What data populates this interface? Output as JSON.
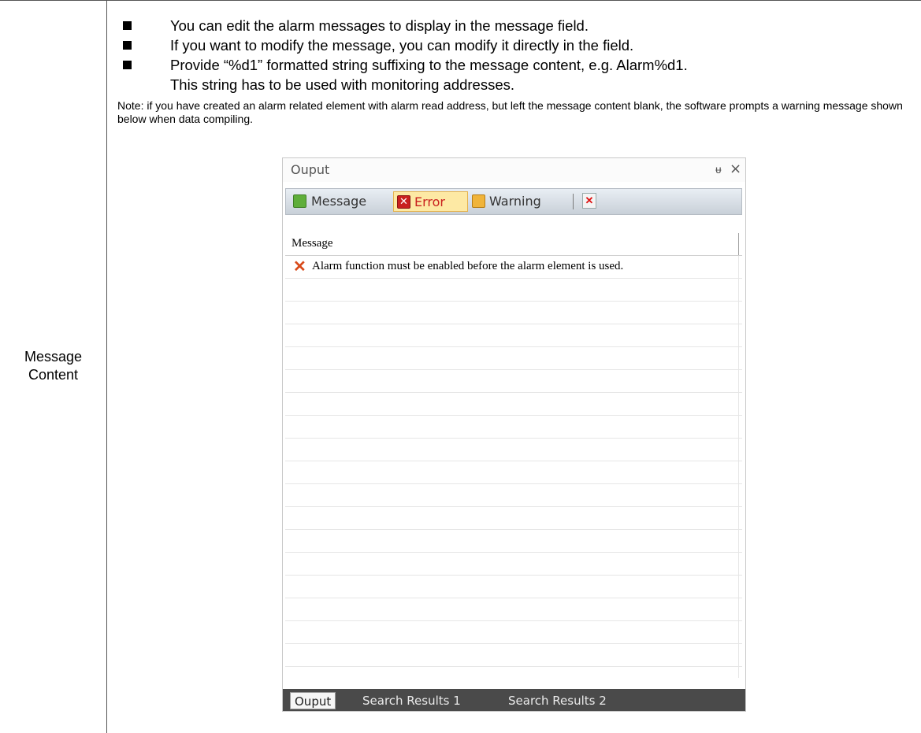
{
  "document": {
    "row_label": "Message Content",
    "bullets": [
      {
        "text": "You can edit the alarm messages to display in the message field."
      },
      {
        "text": "If you want to modify the message, you can modify it directly in the field."
      },
      {
        "text": "Provide “%d1” formatted string suffixing to the message content, e.g. Alarm%d1.",
        "line2": "This string has to be used with monitoring addresses."
      }
    ],
    "note": "Note: if you have created an alarm related element with alarm read address, but left the message content blank, the software prompts a warning message shown below when data compiling."
  },
  "output_panel": {
    "title": "Ouput",
    "pin_glyph": "ᵾ",
    "close_glyph": "×",
    "toolbar": {
      "message_label": "Message",
      "error_label": "Error",
      "warning_label": "Warning",
      "active": "Error"
    },
    "grid": {
      "column_header": "Message",
      "rows": [
        {
          "icon": "error-icon",
          "text": "Alarm function must be enabled before the alarm element is used."
        }
      ]
    },
    "tabs": [
      {
        "label": "Ouput",
        "active": true
      },
      {
        "label": "Search Results 1",
        "active": false
      },
      {
        "label": "Search Results 2",
        "active": false
      }
    ]
  },
  "colors": {
    "error_accent": "#c9201e",
    "active_tab_bg": "#fde9a4",
    "tabbar_bg": "#4a4a4a"
  }
}
